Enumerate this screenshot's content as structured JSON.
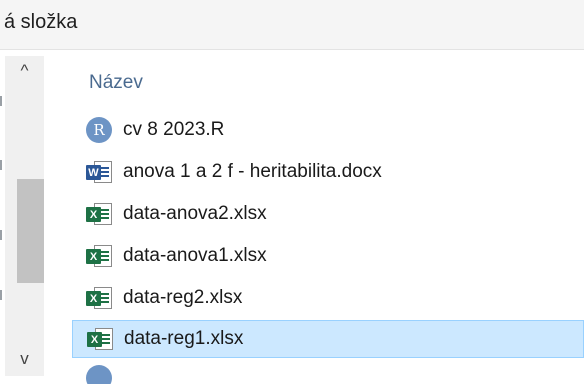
{
  "breadcrumb": {
    "text": "á složka"
  },
  "list": {
    "column_header": "Název",
    "files": [
      {
        "name": "cv 8 2023.R",
        "type": "r",
        "icon": "r-script-icon",
        "badge": "R"
      },
      {
        "name": "anova 1 a 2 f - heritabilita.docx",
        "type": "docx",
        "icon": "word-document-icon",
        "badge": "W"
      },
      {
        "name": "data-anova2.xlsx",
        "type": "xlsx",
        "icon": "excel-spreadsheet-icon",
        "badge": "X"
      },
      {
        "name": "data-anova1.xlsx",
        "type": "xlsx",
        "icon": "excel-spreadsheet-icon",
        "badge": "X"
      },
      {
        "name": "data-reg2.xlsx",
        "type": "xlsx",
        "icon": "excel-spreadsheet-icon",
        "badge": "X"
      },
      {
        "name": "data-reg1.xlsx",
        "type": "xlsx",
        "icon": "excel-spreadsheet-icon",
        "badge": "X",
        "selected": true
      }
    ]
  },
  "scrollbar": {
    "up_glyph": "^",
    "down_glyph": "v"
  },
  "colors": {
    "selection_bg": "#cce8ff",
    "selection_border": "#99d1ff",
    "header_text": "#4a6a8f"
  }
}
